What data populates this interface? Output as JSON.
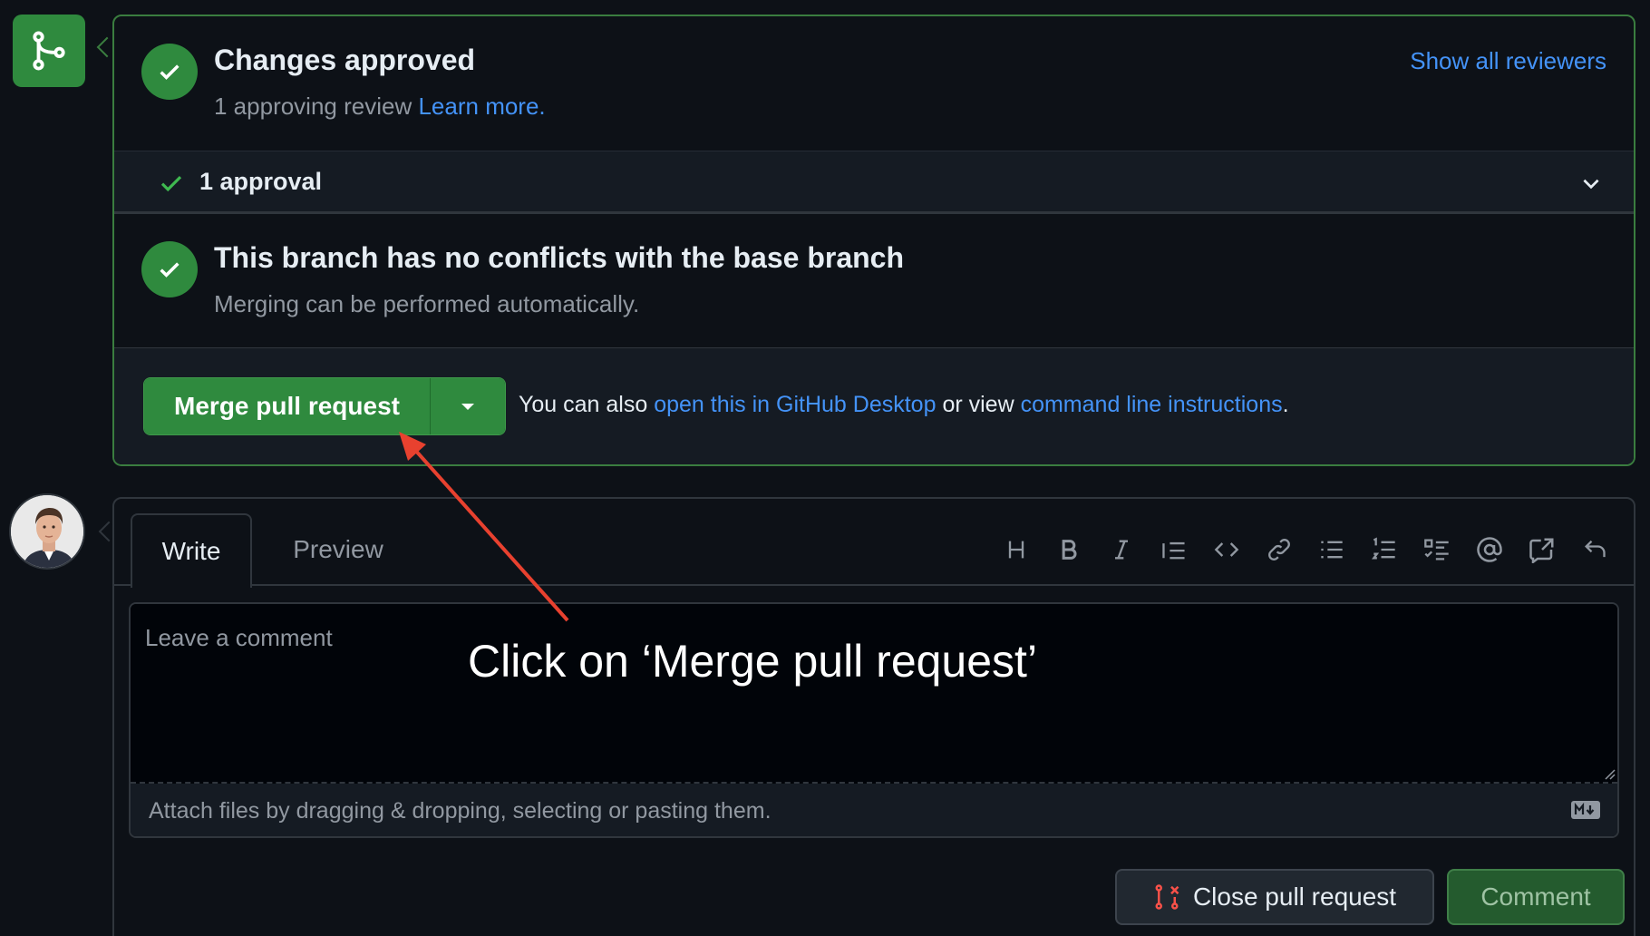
{
  "merge_box": {
    "approved_title": "Changes approved",
    "approved_sub": "1 approving review",
    "learn_more": "Learn more.",
    "show_reviewers": "Show all reviewers",
    "approvals_label": "1 approval",
    "conflicts_title": "This branch has no conflicts with the base branch",
    "conflicts_sub": "Merging can be performed automatically.",
    "merge_button": "Merge pull request",
    "hint_prefix": "You can also",
    "hint_link1": "open this in GitHub Desktop",
    "hint_middle": "or view",
    "hint_link2": "command line instructions",
    "hint_suffix": "."
  },
  "comment_box": {
    "tab_write": "Write",
    "tab_preview": "Preview",
    "toolbar": [
      "heading-icon",
      "bold-icon",
      "italic-icon",
      "quote-icon",
      "code-icon",
      "link-icon",
      "unordered-list-icon",
      "ordered-list-icon",
      "task-list-icon",
      "mention-icon",
      "reference-icon",
      "reply-icon"
    ],
    "placeholder": "Leave a comment",
    "attach_text": "Attach files by dragging & dropping, selecting or pasting them.",
    "close_button": "Close pull request",
    "comment_button": "Comment"
  },
  "annotation": {
    "text": "Click on ‘Merge pull request’"
  },
  "colors": {
    "accent_green": "#2f8a3e",
    "link_blue": "#4493f8",
    "annotation_red": "#e8412f",
    "background": "#0d1117"
  }
}
